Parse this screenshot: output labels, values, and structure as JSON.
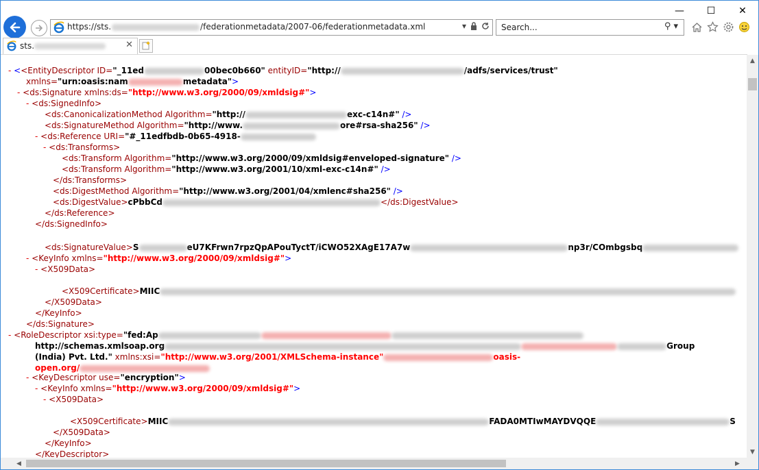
{
  "window": {
    "minimize": "—",
    "maximize": "☐",
    "close": "✕"
  },
  "address": {
    "url_prefix": "https://sts.",
    "url_suffix": "/federationmetadata/2007-06/federationmetadata.xml"
  },
  "search": {
    "placeholder": "Search..."
  },
  "tab": {
    "title": "sts."
  },
  "xml": {
    "l1_tag": "<EntityDescriptor",
    "l1_attr": "ID=",
    "l1_val_a": "\"_11ed",
    "l1_val_b": "00bec0b660\"",
    "l1_attr2": "entityID=",
    "l1_val2_a": "\"http://",
    "l1_val2_b": "/adfs/services/trust\"",
    "l2_attr": "xmlns=",
    "l2_val_a": "\"urn:oasis:nam",
    "l2_val_b": "metadata\"",
    "l2_close": ">",
    "l3_tag": "<ds:Signature",
    "l3_attr": "xmlns:ds=",
    "l3_val": "\"http://www.w3.org/2000/09/xmldsig#\"",
    "l4_tag": "<ds:SignedInfo>",
    "l5_tag": "<ds:CanonicalizationMethod",
    "l5_attr": "Algorithm=",
    "l5_val_a": "\"http://",
    "l5_val_b": "exc-c14n#\"",
    "l5_close": " />",
    "l6_tag": "<ds:SignatureMethod",
    "l6_attr": "Algorithm=",
    "l6_val_a": "\"http://www.",
    "l6_val_b": "ore#rsa-sha256\"",
    "l6_close": " />",
    "l7_tag": "<ds:Reference",
    "l7_attr": "URI=",
    "l7_val": "\"#_11edfbdb-0b65-4918-",
    "l8_tag": "<ds:Transforms>",
    "l9_tag": "<ds:Transform",
    "l9_attr": "Algorithm=",
    "l9_val": "\"http://www.w3.org/2000/09/xmldsig#enveloped-signature\"",
    "l9_close": " />",
    "l10_tag": "<ds:Transform",
    "l10_attr": "Algorithm=",
    "l10_val": "\"http://www.w3.org/2001/10/xml-exc-c14n#\"",
    "l10_close": " />",
    "l11_tag": "</ds:Transforms>",
    "l12_tag": "<ds:DigestMethod",
    "l12_attr": "Algorithm=",
    "l12_val": "\"http://www.w3.org/2001/04/xmlenc#sha256\"",
    "l12_close": " />",
    "l13_tag": "<ds:DigestValue>",
    "l13_val": "cPbbCd",
    "l13_close": "</ds:DigestValue>",
    "l14_tag": "</ds:Reference>",
    "l15_tag": "</ds:SignedInfo>",
    "l16_tag": "<ds:SignatureValue>",
    "l16_val_a": "S",
    "l16_val_b": "eU7KFrwn7rpzQpAPouTyctT/iCWO52XAgE17A7w",
    "l16_val_c": "np3r/COmbgsbq",
    "l17_tag": "<KeyInfo",
    "l17_attr": "xmlns=",
    "l17_val": "\"http://www.w3.org/2000/09/xmldsig#\"",
    "l17_close": ">",
    "l18_tag": "<X509Data>",
    "l19_tag": "<X509Certificate>",
    "l19_val": "MIIC",
    "l20_tag": "</X509Data>",
    "l21_tag": "</KeyInfo>",
    "l22_tag": "</ds:Signature>",
    "l23_tag": "<RoleDescriptor",
    "l23_attr": "xsi:type=",
    "l23_val": "\"fed:Ap",
    "l24_val_a": "http://schemas.xmlsoap.org",
    "l24_val_b": "Group",
    "l25_val": "(India) Pvt. Ltd.\"",
    "l25_attr": "xmlns:xsi=",
    "l25_red": "\"http://www.w3.org/2001/XMLSchema-instance\"",
    "l25_red2": "oasis-",
    "l26_red": "open.org/",
    "l27_tag": "<KeyDescriptor",
    "l27_attr": "use=",
    "l27_val": "\"encryption\"",
    "l27_close": ">",
    "l28_tag": "<KeyInfo",
    "l28_attr": "xmlns=",
    "l28_val": "\"http://www.w3.org/2000/09/xmldsig#\"",
    "l28_close": ">",
    "l29_tag": "<X509Data>",
    "l30_tag": "<X509Certificate>",
    "l30_val_a": "MIIC",
    "l30_val_b": "FADA0MTIwMAYDVQQE",
    "l30_val_c": "S",
    "l31_tag": "</X509Data>",
    "l32_tag": "</KeyInfo>",
    "l33_tag": "</KeyDescriptor>",
    "dash": "-"
  }
}
